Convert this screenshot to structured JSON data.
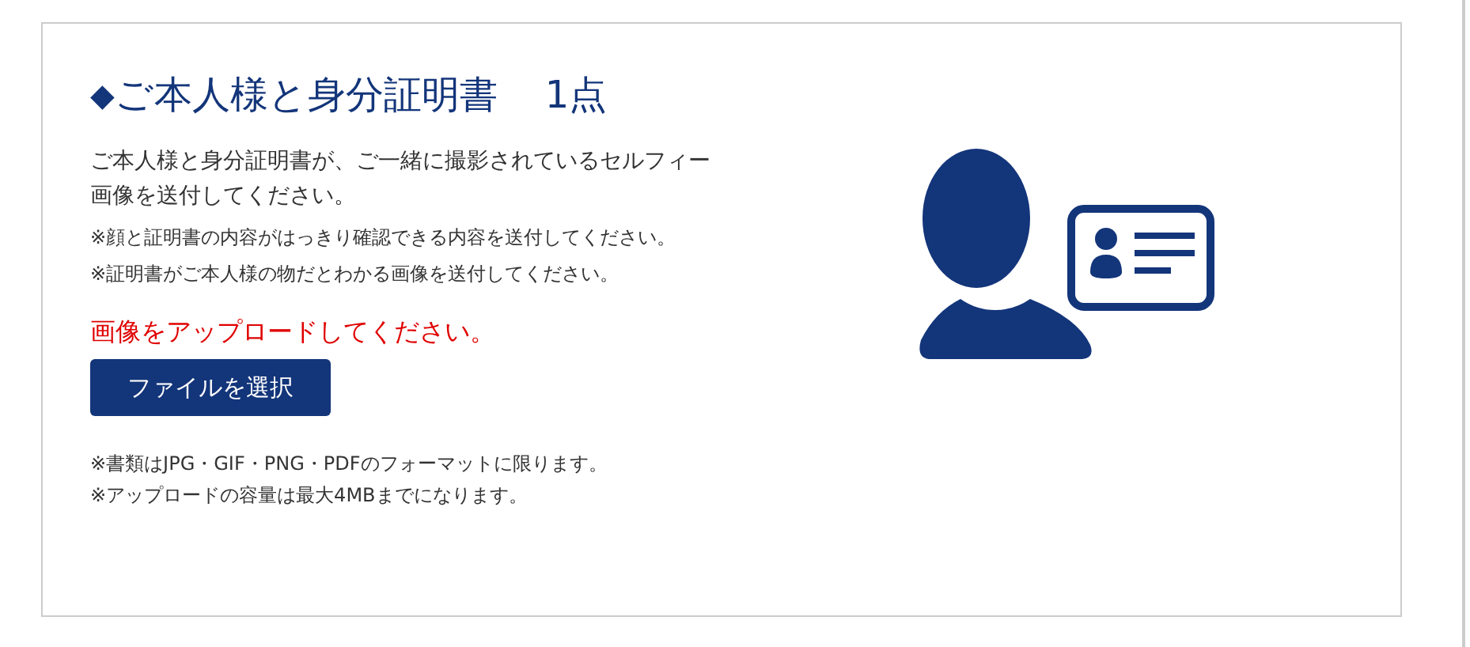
{
  "heading": {
    "marker": "◆",
    "title": "ご本人様と身分証明書",
    "count": "1点"
  },
  "description": "ご本人様と身分証明書が、ご一緒に撮影されているセルフィー画像を送付してください。",
  "notes": [
    "※顔と証明書の内容がはっきり確認できる内容を送付してください。",
    "※証明書がご本人様の物だとわかる画像を送付してください。"
  ],
  "error": "画像をアップロードしてください。",
  "button": "ファイルを選択",
  "format_notes": [
    "※書類はJPG・GIF・PNG・PDFのフォーマットに限ります。",
    "※アップロードの容量は最大4MBまでになります。"
  ]
}
